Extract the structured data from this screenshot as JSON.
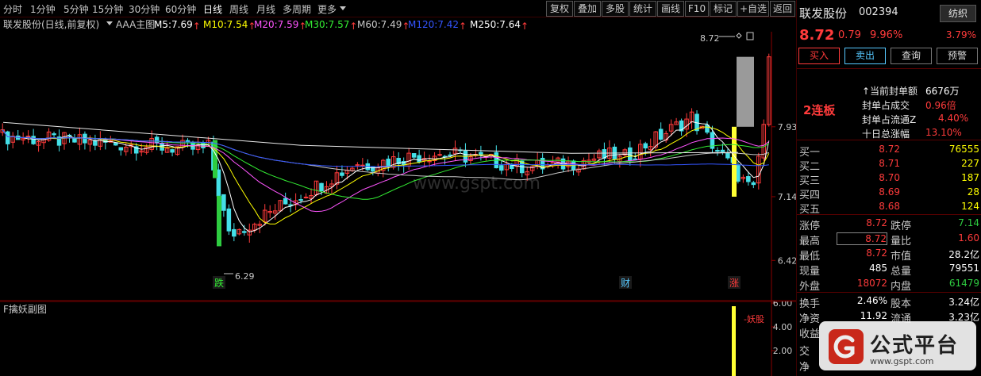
{
  "toolbar": {
    "periods": [
      "分时",
      "1分钟",
      "5分钟",
      "15分钟",
      "30分钟",
      "60分钟",
      "日线",
      "周线",
      "月线",
      "多周期",
      "更多"
    ],
    "active_period": "日线",
    "buttons": [
      "复权",
      "叠加",
      "多股",
      "统计",
      "画线",
      "F10",
      "标记",
      "+自选",
      "返回"
    ]
  },
  "info_line": {
    "stock_label": "联发股份(日线,前复权)",
    "indicator": "AAA主图",
    "ma": [
      {
        "label": "M5:",
        "value": "7.69",
        "color": "#ffffff"
      },
      {
        "label": "M10:",
        "value": "7.54",
        "color": "#ffff00"
      },
      {
        "label": "M20:",
        "value": "7.59",
        "color": "#ff55ff"
      },
      {
        "label": "M30:",
        "value": "7.57",
        "color": "#33ee33"
      },
      {
        "label": "M60:",
        "value": "7.49",
        "color": "#c8c8c8"
      },
      {
        "label": "M120:",
        "value": "7.42",
        "color": "#3355ff"
      },
      {
        "label": "M250:",
        "value": "7.64",
        "color": "#ffffff"
      }
    ]
  },
  "main_chart": {
    "axis_labels": [
      "7.93",
      "7.14",
      "6.42"
    ],
    "high_marker": "8.72",
    "low_marker": "6.29",
    "event_labels": [
      "跌",
      "财",
      "涨"
    ],
    "watermark": "www.gspt.com"
  },
  "sub_chart": {
    "title": "F擒妖副图",
    "axis_labels": [
      "6.00",
      "4.00",
      "2.00"
    ],
    "signal_text": "妖股"
  },
  "quote": {
    "name": "联发股份",
    "code": "002394",
    "sector": "纺织",
    "price": "8.72",
    "change": "0.79",
    "change_pct": "9.96%",
    "side_pct": "3.79%",
    "actions": [
      "买入",
      "卖出",
      "查询",
      "预警"
    ],
    "board_tag": "2连板",
    "limit_stats": [
      {
        "label": "当前封单额",
        "value": "6676万"
      },
      {
        "label": "封单占成交",
        "value": "0.96倍"
      },
      {
        "label": "封单占流通Z",
        "value": "4.40%"
      },
      {
        "label": "十日总涨幅",
        "value": "13.10%"
      }
    ],
    "bids": [
      {
        "label": "买一",
        "price": "8.72",
        "vol": "76555"
      },
      {
        "label": "买二",
        "price": "8.71",
        "vol": "227"
      },
      {
        "label": "买三",
        "price": "8.70",
        "vol": "187"
      },
      {
        "label": "买四",
        "price": "8.69",
        "vol": "28"
      },
      {
        "label": "买五",
        "price": "8.68",
        "vol": "124"
      }
    ],
    "stats": [
      {
        "l1": "涨停",
        "v1": "8.72",
        "c1": "red",
        "l2": "跌停",
        "v2": "7.14",
        "c2": "green"
      },
      {
        "l1": "最高",
        "v1": "8.72",
        "c1": "red",
        "l2": "量比",
        "v2": "1.60",
        "c2": "red"
      },
      {
        "l1": "最低",
        "v1": "8.72",
        "c1": "red",
        "l2": "市值",
        "v2": "28.2亿",
        "c2": "white"
      },
      {
        "l1": "现量",
        "v1": "485",
        "c1": "white",
        "l2": "总量",
        "v2": "79551",
        "c2": "white"
      },
      {
        "l1": "外盘",
        "v1": "18072",
        "c1": "red",
        "l2": "内盘",
        "v2": "61479",
        "c2": "green"
      }
    ],
    "stats2": [
      {
        "l1": "换手",
        "v1": "2.46%",
        "l2": "股本",
        "v2": "3.24亿"
      },
      {
        "l1": "净资",
        "v1": "11.92",
        "l2": "流通",
        "v2": "3.23亿"
      },
      {
        "l1": "收益",
        "v1": "",
        "l2": "",
        "v2": ""
      }
    ],
    "footer_labels": [
      "交",
      "净"
    ]
  },
  "brand": {
    "name": "公式平台",
    "url": "www.gspt.com"
  },
  "colors": {
    "up": "#ff3b3b",
    "down": "#44e0e8",
    "background": "#000000",
    "grid": "#5a0000"
  }
}
